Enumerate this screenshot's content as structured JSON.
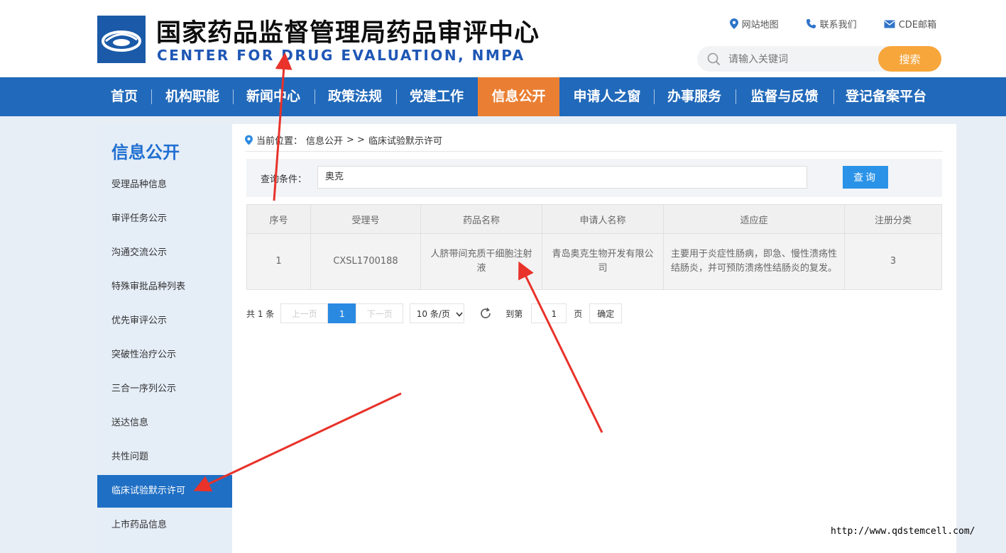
{
  "header": {
    "title_cn": "国家药品监督管理局药品审评中心",
    "title_en": "CENTER FOR DRUG EVALUATION, NMPA",
    "links": [
      "网站地图",
      "联系我们",
      "CDE邮箱"
    ],
    "search_placeholder": "请输入关键词",
    "search_button": "搜索"
  },
  "nav": {
    "items": [
      "首页",
      "机构职能",
      "新闻中心",
      "政策法规",
      "党建工作",
      "信息公开",
      "申请人之窗",
      "办事服务",
      "监督与反馈",
      "登记备案平台"
    ],
    "active_index": 5
  },
  "sidebar": {
    "title": "信息公开",
    "items": [
      "受理品种信息",
      "审评任务公示",
      "沟通交流公示",
      "特殊审批品种列表",
      "优先审评公示",
      "突破性治疗公示",
      "三合一序列公示",
      "送达信息",
      "共性问题",
      "临床试验默示许可",
      "上市药品信息"
    ],
    "active_index": 9
  },
  "breadcrumb": {
    "prefix": "当前位置：",
    "section": "信息公开",
    "sep": "> >",
    "current": "临床试验默示许可"
  },
  "query": {
    "label": "查询条件：",
    "value": "奥克",
    "button": "查询"
  },
  "table": {
    "headers": [
      "序号",
      "受理号",
      "药品名称",
      "申请人名称",
      "适应症",
      "注册分类"
    ],
    "rows": [
      [
        "1",
        "CXSL1700188",
        "人脐带间充质干细胞注射液",
        "青岛奥克生物开发有限公司",
        "主要用于炎症性肠病，即急、慢性溃疡性结肠炎，并可预防溃疡性结肠炎的复发。",
        "3"
      ]
    ]
  },
  "pagination": {
    "total": "共 1 条",
    "prev": "上一页",
    "current": "1",
    "next": "下一页",
    "page_size": "10 条/页",
    "goto_label": "到第",
    "goto_value": "1",
    "page_unit": "页",
    "confirm": "确定"
  },
  "watermark_url": "http://www.qdstemcell.com/",
  "colors": {
    "nav_bg": "#2169ba",
    "nav_active": "#ea7f33",
    "search_button": "#f7a63c",
    "sidebar_active": "#1f6fc4",
    "query_button": "#2a93e8",
    "annotation_arrow": "#e8322a"
  }
}
